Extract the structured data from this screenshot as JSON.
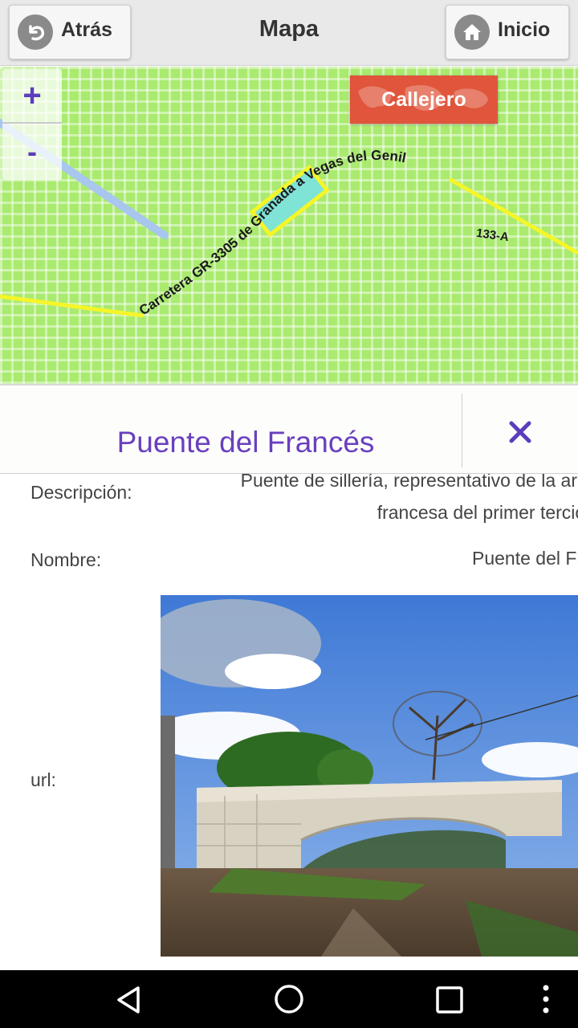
{
  "header": {
    "back_label": "Atrás",
    "title": "Mapa",
    "home_label": "Inicio"
  },
  "map": {
    "zoom_in_label": "+",
    "zoom_out_label": "-",
    "callejero_label": "Callejero",
    "road_label_1": "Carretera GR-3305 de Granada a Vegas del Genil",
    "road_label_2": "133-A",
    "colors": {
      "land": "#a9ea6f",
      "road_major": "#f5f529",
      "road_minor": "#a9c6ee",
      "highlight": "#7fe3d6"
    }
  },
  "panel": {
    "title": "Puente del Francés",
    "close_icon": "close-icon"
  },
  "details": {
    "descripcion_label": "Descripción:",
    "descripcion_line1": "Puente de sillería, representativo de la arquitectura",
    "descripcion_line2": "francesa del primer tercio del siglo",
    "nombre_label": "Nombre:",
    "nombre_value": "Puente del Francés",
    "url_label": "url:"
  },
  "navbar": {
    "icons": [
      "back-triangle-icon",
      "home-circle-icon",
      "recents-square-icon",
      "overflow-menu-icon"
    ]
  }
}
